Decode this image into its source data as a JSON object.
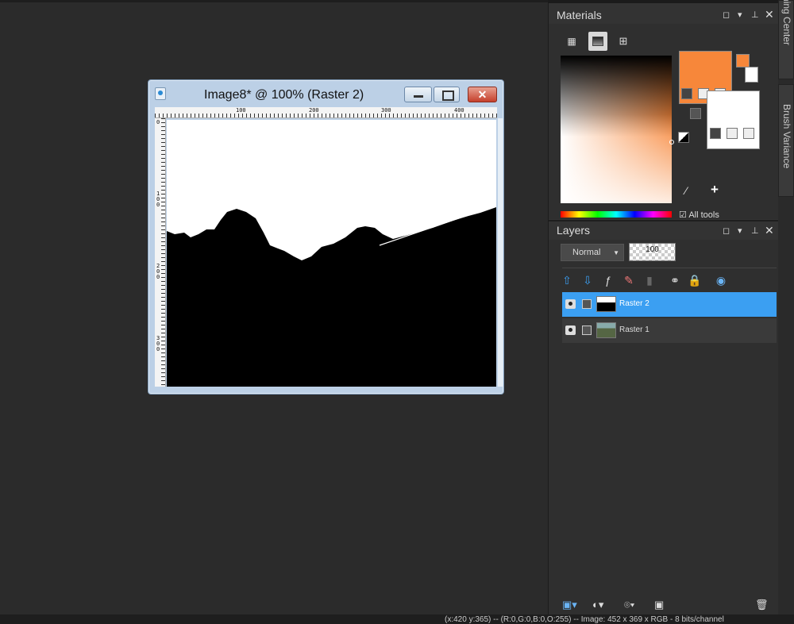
{
  "image_window": {
    "title": "Image8* @ 100% (Raster 2)",
    "close_glyph": "✕",
    "ruler_top_ticks": [
      "100",
      "200",
      "300",
      "400"
    ],
    "ruler_left_ticks": [
      "0",
      "1\n0\n0",
      "2\n0\n0",
      "3\n0\n0"
    ]
  },
  "materials": {
    "title": "Materials",
    "primary_color": "#f7873a",
    "secondary_color": "#ffffff",
    "all_tools_label": "All tools"
  },
  "layers": {
    "title": "Layers",
    "blend_mode": "Normal",
    "opacity": "100",
    "items": [
      {
        "name": "Raster 2",
        "selected": true
      },
      {
        "name": "Raster 1",
        "selected": false
      }
    ]
  },
  "side_tabs": {
    "learning_center": "Learning Center",
    "brush_variance": "Brush Variance"
  },
  "status": {
    "text": "(x:420 y:365) -- (R:0,G:0,B:0,O:255) -- Image: 452 x 369 x RGB - 8 bits/channel"
  }
}
